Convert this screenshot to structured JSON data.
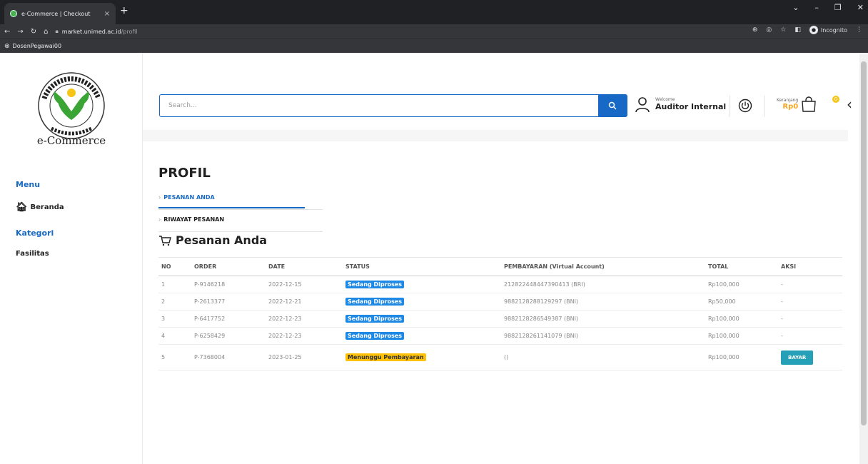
{
  "browser": {
    "tab_title": "e-Commerce | Checkout",
    "tab_close": "×",
    "new_tab": "+",
    "url_domain": "market.unimed.ac.id",
    "url_path": "/profil",
    "incognito_label": "Incognito",
    "bookmark": "DosenPegawai00"
  },
  "sidebar": {
    "logo_text": "e-Commerce",
    "logo_lettering": "UNIVERSITAS NEGERI MEDAN UNIMED",
    "menu_heading": "Menu",
    "menu_items": [
      {
        "label": "Beranda",
        "icon": "home-icon"
      }
    ],
    "category_heading": "Kategori",
    "category_items": [
      {
        "label": "Fasilitas"
      }
    ]
  },
  "header": {
    "search_placeholder": "Search...",
    "welcome": "Welcome",
    "user_name": "Auditor Internal",
    "cart_label": "Keranjang",
    "cart_amount": "Rp0",
    "cart_count": "0"
  },
  "profile": {
    "title": "PROFIL",
    "tabs": [
      {
        "label": "PESANAN ANDA",
        "active": true
      },
      {
        "label": "RIWAYAT PESANAN",
        "active": false
      }
    ],
    "section_title": "Pesanan Anda"
  },
  "orders": {
    "columns": [
      "NO",
      "ORDER",
      "DATE",
      "STATUS",
      "PEMBAYARAN (Virtual Account)",
      "TOTAL",
      "AKSI"
    ],
    "rows": [
      {
        "no": "1",
        "order": "P-9146218",
        "date": "2022-12-15",
        "status": "Sedang Diproses",
        "status_color": "blue",
        "payment": "212822448447390413 (BRI)",
        "total": "Rp100,000",
        "action": "-"
      },
      {
        "no": "2",
        "order": "P-2613377",
        "date": "2022-12-21",
        "status": "Sedang Diproses",
        "status_color": "blue",
        "payment": "9882128288129297 (BNI)",
        "total": "Rp50,000",
        "action": "-"
      },
      {
        "no": "3",
        "order": "P-6417752",
        "date": "2022-12-23",
        "status": "Sedang Diproses",
        "status_color": "blue",
        "payment": "9882128286549387 (BNI)",
        "total": "Rp100,000",
        "action": "-"
      },
      {
        "no": "4",
        "order": "P-6258429",
        "date": "2022-12-23",
        "status": "Sedang Diproses",
        "status_color": "blue",
        "payment": "9882128261141079 (BNI)",
        "total": "Rp100,000",
        "action": "-"
      },
      {
        "no": "5",
        "order": "P-7368004",
        "date": "2023-01-25",
        "status": "Menunggu Pembayaran",
        "status_color": "yellow",
        "payment": "()",
        "total": "Rp100,000",
        "action": "BAYAR"
      }
    ]
  },
  "colors": {
    "primary": "#1769c5",
    "pill_blue": "#1e88e5",
    "pill_yellow": "#ffc107",
    "pay_button": "#26a0b7",
    "cart_amount": "#f5a623"
  }
}
